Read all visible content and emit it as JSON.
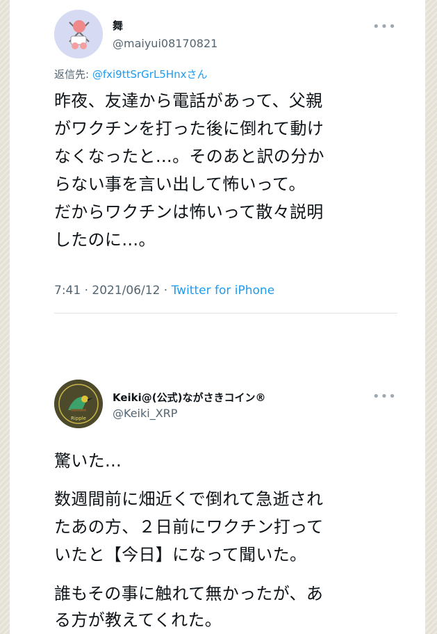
{
  "tweet1": {
    "display_name": "舞",
    "handle": "@maiyui08170821",
    "reply_prefix": "返信先: ",
    "reply_mention": "@fxi9ttSrGrL5Hnxさん",
    "lines": [
      "昨夜、友達から電話があって、父親",
      "がワクチンを打った後に倒れて動け",
      "なくなったと…。そのあと訳の分か",
      "らない事を言い出して怖いって。",
      "だからワクチンは怖いって散々説明",
      "したのに…。"
    ],
    "time": "7:41",
    "date": "2021/06/12",
    "source": "Twitter for iPhone",
    "more_icon": "more-dots-icon"
  },
  "tweet2": {
    "display_name": "Keiki@(公式)ながさきコイン®",
    "handle": "@Keiki_XRP",
    "avatar_text": "Ripple",
    "para1": [
      "驚いた…"
    ],
    "para2": [
      "数週間前に畑近くで倒れて急逝され",
      "たあの方、２日前にワクチン打って",
      "いたと【今日】になって聞いた。"
    ],
    "para3": [
      "誰もその事に触れて無かったが、あ",
      "る方が教えてくれた。"
    ],
    "more_icon": "more-dots-icon"
  },
  "colors": {
    "link": "#1d9bf0",
    "secondary_text": "#536471",
    "primary_text": "#0f1419"
  }
}
